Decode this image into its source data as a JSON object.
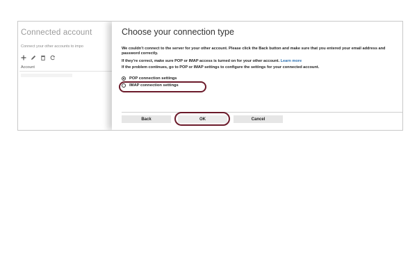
{
  "background": {
    "title": "Connected account",
    "subtitle": "Connect your other accounts to impo",
    "toolbar": [
      "plus-icon",
      "pencil-icon",
      "trash-icon",
      "refresh-icon"
    ],
    "column_header": "Account"
  },
  "dialog": {
    "title": "Choose your connection type",
    "message1": "We couldn’t connect to the server for your other account. Please click the Back button and make sure that you entered your email address and password correctly.",
    "message2_prefix": "If they’re correct, make sure POP or IMAP access is turned on for your other account.",
    "message2_link": "Learn more",
    "message3": "If the problem continues, go to POP or IMAP settings to configure the settings for your connected account.",
    "options": [
      {
        "label": "POP connection settings",
        "selected": true
      },
      {
        "label": "IMAP connection settings",
        "selected": false
      }
    ],
    "buttons": {
      "back": "Back",
      "ok": "OK",
      "cancel": "Cancel"
    }
  },
  "colors": {
    "highlight": "#6b1a2a",
    "link": "#2a6fb0"
  }
}
